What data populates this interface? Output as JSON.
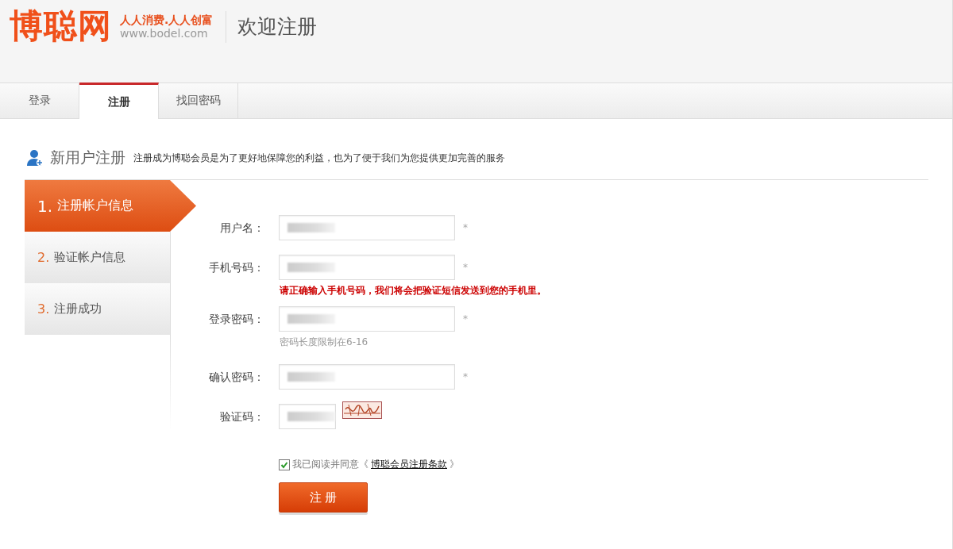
{
  "header": {
    "logo": "博聪网",
    "slogan": "人人消费.人人创富",
    "url": "www.bodel.com",
    "title": "欢迎注册"
  },
  "tabs": [
    {
      "label": "登录",
      "selected": false
    },
    {
      "label": "注册",
      "selected": true
    },
    {
      "label": "找回密码",
      "selected": false
    }
  ],
  "section": {
    "title": "新用户注册",
    "description": "注册成为博聪会员是为了更好地保障您的利益，也为了便于我们为您提供更加完善的服务"
  },
  "steps": [
    {
      "number": "1.",
      "label": "注册帐户信息",
      "selected": true
    },
    {
      "number": "2.",
      "label": "验证帐户信息",
      "selected": false
    },
    {
      "number": "3.",
      "label": "注册成功",
      "selected": false
    }
  ],
  "fields": [
    {
      "label": "用户名：",
      "kind": "text",
      "value_blurred": true,
      "marker": "*"
    },
    {
      "label": "手机号码：",
      "kind": "text",
      "value_blurred": true,
      "marker": "*",
      "note": {
        "kind": "error",
        "text": "请正确输入手机号码，我们将会把验证短信发送到您的手机里。"
      }
    },
    {
      "label": "登录密码：",
      "kind": "text",
      "value_blurred": true,
      "marker": "*",
      "note": {
        "kind": "hint",
        "text": "密码长度限制在6-16"
      }
    },
    {
      "label": "确认密码：",
      "kind": "text",
      "value_blurred": true,
      "marker": "*"
    },
    {
      "label": "验证码：",
      "kind": "captcha",
      "value_blurred": true
    }
  ],
  "agreement": {
    "checked": true,
    "text": "我已阅读并同意《",
    "link": "博聪会员注册条款",
    "suffix": "》"
  },
  "submit": "注 册"
}
